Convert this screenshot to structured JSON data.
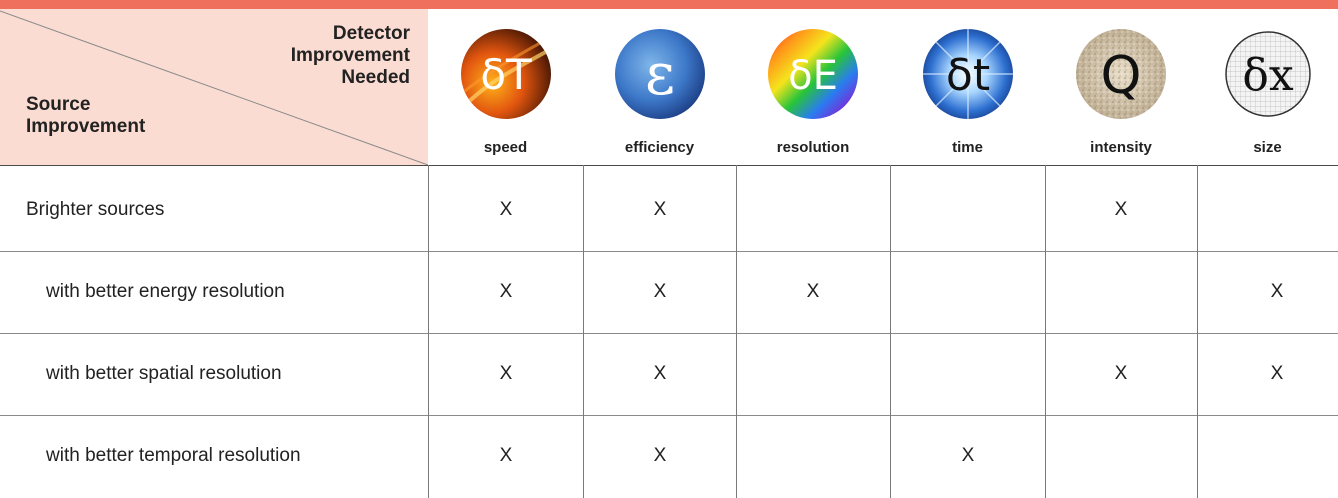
{
  "corner": {
    "detector_line1": "Detector",
    "detector_line2": "Improvement",
    "detector_line3": "Needed",
    "source_line1": "Source",
    "source_line2": "Improvement"
  },
  "columns": [
    {
      "symbol": "δT",
      "label": "speed",
      "icon": "flame-icon"
    },
    {
      "symbol": "ε",
      "label": "efficiency",
      "icon": "blue-sphere-icon"
    },
    {
      "symbol": "δE",
      "label": "resolution",
      "icon": "rainbow-icon"
    },
    {
      "symbol": "δt",
      "label": "time",
      "icon": "burst-icon"
    },
    {
      "symbol": "Q",
      "label": "intensity",
      "icon": "grain-icon"
    },
    {
      "symbol": "δx",
      "label": "size",
      "icon": "grid-icon"
    }
  ],
  "rows": [
    {
      "label": "Brighter sources",
      "marks": [
        "X",
        "X",
        "",
        "",
        "X",
        ""
      ]
    },
    {
      "label": "with better energy resolution",
      "marks": [
        "X",
        "X",
        "X",
        "",
        "",
        "X"
      ]
    },
    {
      "label": "with better spatial resolution",
      "marks": [
        "X",
        "X",
        "",
        "",
        "X",
        "X"
      ]
    },
    {
      "label": "with better temporal resolution",
      "marks": [
        "X",
        "X",
        "",
        "X",
        "",
        ""
      ]
    }
  ],
  "colors": {
    "accent_bar": "#f0705e",
    "header_fill": "#fbdcd3"
  }
}
